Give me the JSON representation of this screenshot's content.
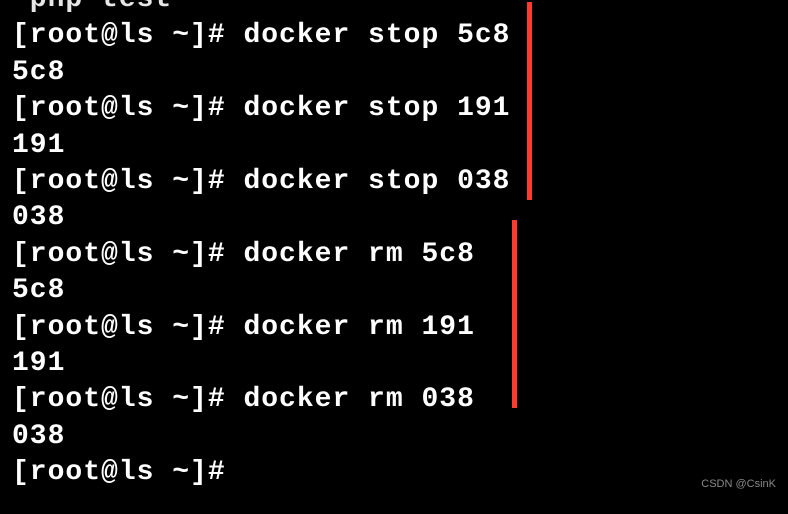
{
  "terminal": {
    "partial_top": " php test",
    "lines": [
      {
        "prompt": "[root@ls ~]# ",
        "command": "docker stop 5c8"
      },
      {
        "output": "5c8"
      },
      {
        "prompt": "[root@ls ~]# ",
        "command": "docker stop 191"
      },
      {
        "output": "191"
      },
      {
        "prompt": "[root@ls ~]# ",
        "command": "docker stop 038"
      },
      {
        "output": "038"
      },
      {
        "prompt": "[root@ls ~]# ",
        "command": "docker rm 5c8"
      },
      {
        "output": "5c8"
      },
      {
        "prompt": "[root@ls ~]# ",
        "command": "docker rm 191"
      },
      {
        "output": "191"
      },
      {
        "prompt": "[root@ls ~]# ",
        "command": "docker rm 038"
      },
      {
        "output": "038"
      },
      {
        "prompt": "[root@ls ~]# ",
        "command": ""
      }
    ]
  },
  "watermark": "CSDN @CsinK"
}
